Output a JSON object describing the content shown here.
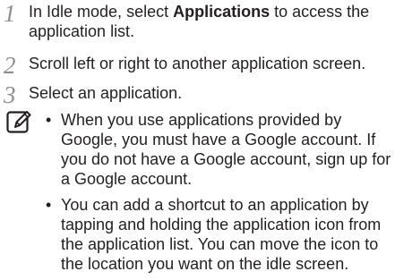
{
  "steps": [
    {
      "number": "1",
      "text_before": "In Idle mode, select ",
      "text_bold": "Applications",
      "text_after": " to access the application list."
    },
    {
      "number": "2",
      "text": "Scroll left or right to another application screen."
    },
    {
      "number": "3",
      "text": "Select an application."
    }
  ],
  "note": {
    "icon": "note-pencil-icon",
    "bullet": "•",
    "items": [
      "When you use applications provided by Google, you must have a Google account. If you do not have a Google account, sign up for a Google account.",
      "You can add a shortcut to an application by tapping and holding the application icon from the application list. You can move the icon to the location you want on the idle screen."
    ]
  }
}
